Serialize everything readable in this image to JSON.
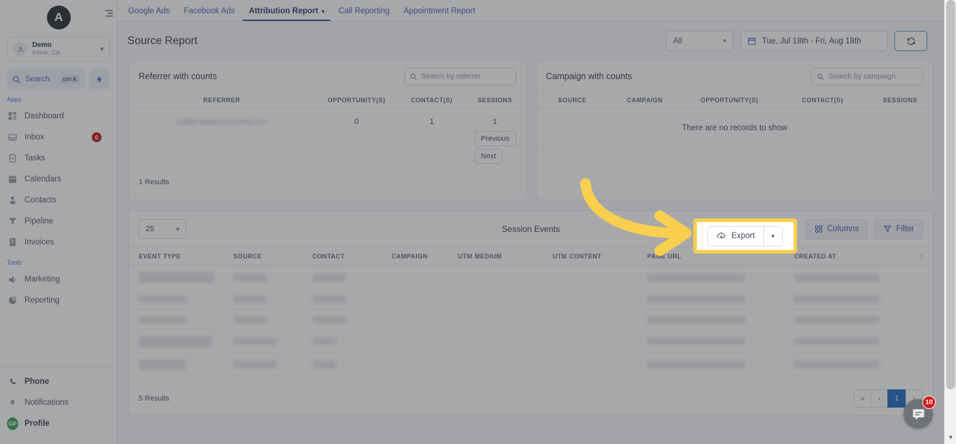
{
  "sidebar": {
    "logo_letter": "A",
    "account": {
      "name": "Demo",
      "location": "Irvine, CA"
    },
    "search": {
      "label": "Search",
      "shortcut": "ctrl K"
    },
    "groups": [
      {
        "label": "Apps"
      },
      {
        "label": "Tools"
      }
    ],
    "apps": [
      {
        "label": "Dashboard",
        "icon": "dashboard-icon",
        "badge": ""
      },
      {
        "label": "Inbox",
        "icon": "inbox-icon",
        "badge": "0"
      },
      {
        "label": "Tasks",
        "icon": "tasks-icon",
        "badge": ""
      },
      {
        "label": "Calendars",
        "icon": "calendar-icon",
        "badge": ""
      },
      {
        "label": "Contacts",
        "icon": "contacts-icon",
        "badge": ""
      },
      {
        "label": "Pipeline",
        "icon": "pipeline-icon",
        "badge": ""
      },
      {
        "label": "Invoices",
        "icon": "invoices-icon",
        "badge": ""
      }
    ],
    "tools": [
      {
        "label": "Marketing",
        "icon": "megaphone-icon"
      },
      {
        "label": "Reporting",
        "icon": "pie-chart-icon"
      }
    ],
    "bottom": [
      {
        "label": "Phone",
        "icon": "phone-icon"
      },
      {
        "label": "Notifications",
        "icon": "bell-icon"
      },
      {
        "label": "Profile",
        "icon": "avatar-icon",
        "initials": "GP"
      }
    ]
  },
  "tabs": [
    {
      "label": "Google Ads",
      "active": false,
      "caret": false
    },
    {
      "label": "Facebook Ads",
      "active": false,
      "caret": false
    },
    {
      "label": "Attribution Report",
      "active": true,
      "caret": true
    },
    {
      "label": "Call Reporting",
      "active": false,
      "caret": false
    },
    {
      "label": "Appointment Report",
      "active": false,
      "caret": false
    }
  ],
  "header": {
    "title": "Source Report",
    "filter_select": "All",
    "date_range": "Tue, Jul 18th - Fri, Aug 18th",
    "refresh_icon": "refresh-icon"
  },
  "referrer_card": {
    "title": "Referrer with counts",
    "search_placeholder": "Search by referrer",
    "columns": [
      "REFERRER",
      "OPPORTUNITY(S)",
      "CONTACT(S)",
      "SESSIONS"
    ],
    "rows": [
      {
        "referrer": "builder.leadconnectorhq.com",
        "opportunities": "0",
        "contacts": "1",
        "sessions": "1"
      }
    ],
    "results": "1 Results",
    "previous": "Previous",
    "next": "Next"
  },
  "campaign_card": {
    "title": "Campaign with counts",
    "search_placeholder": "Search by campaign",
    "columns": [
      "SOURCE",
      "CAMPAIGN",
      "OPPORTUNITY(S)",
      "CONTACT(S)",
      "SESSIONS"
    ],
    "empty_message": "There are no records to show"
  },
  "session_events": {
    "page_size": "25",
    "title": "Session Events",
    "export_label": "Export",
    "export_icon": "cloud-download-icon",
    "export_caret_icon": "chevron-down-icon",
    "columns_label": "Columns",
    "columns_icon": "columns-icon",
    "filter_label": "Filter",
    "filter_icon": "funnel-icon",
    "columns": [
      "EVENT TYPE",
      "SOURCE",
      "CONTACT",
      "CAMPAIGN",
      "UTM MEDIUM",
      "UTM CONTENT",
      "PAGE URL",
      "CREATED AT"
    ],
    "sort_icon": "sort-icon",
    "row_count": 5,
    "results": "5 Results",
    "pagination": {
      "first": "«",
      "prev": "‹",
      "current": "1",
      "next": "›"
    }
  },
  "chat_widget": {
    "icon": "chat-icon",
    "unread": "10"
  },
  "highlight": {
    "target": "export-button",
    "color": "#F8CF4F"
  },
  "colors": {
    "accent_blue": "#2e4ea8",
    "highlight_yellow": "#F8CF4F",
    "badge_red": "#c40d0d",
    "page_active": "#1565c0"
  }
}
